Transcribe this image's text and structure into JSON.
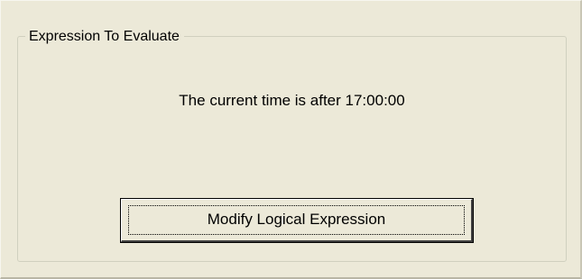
{
  "groupbox": {
    "title": "Expression To Evaluate"
  },
  "expression": {
    "text": "The current time is after 17:00:00"
  },
  "button": {
    "label": "Modify Logical Expression"
  }
}
